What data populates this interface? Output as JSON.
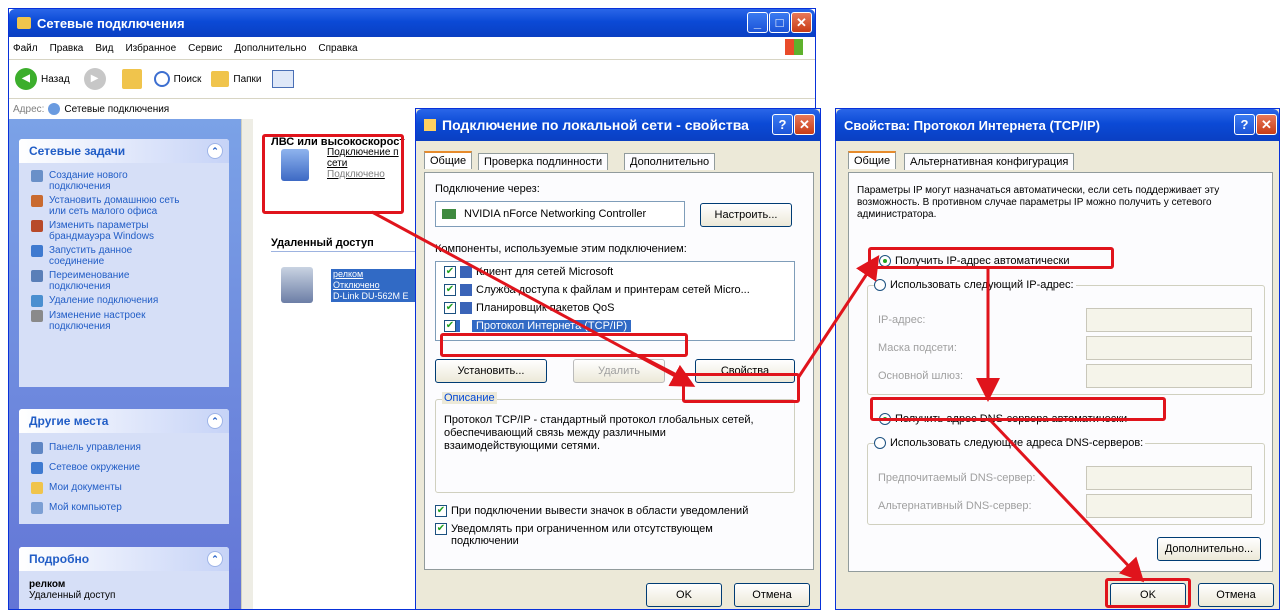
{
  "explorer": {
    "title": "Сетевые подключения",
    "menu": [
      "Файл",
      "Правка",
      "Вид",
      "Избранное",
      "Сервис",
      "Дополнительно",
      "Справка"
    ],
    "toolbar": {
      "back": "Назад",
      "search": "Поиск",
      "folders": "Папки"
    },
    "address_label": "Адрес:",
    "address_value": "Сетевые подключения",
    "tasks_title": "Сетевые задачи",
    "tasks": [
      "Создание нового подключения",
      "Установить домашнюю сеть или сеть малого офиса",
      "Изменить параметры брандмауэра Windows",
      "Запустить данное соединение",
      "Переименование подключения",
      "Удаление подключения",
      "Изменение настроек подключения"
    ],
    "places_title": "Другие места",
    "places": [
      "Панель управления",
      "Сетевое окружение",
      "Мои документы",
      "Мой компьютер"
    ],
    "details_title": "Подробно",
    "details_name": "релком",
    "details_sub": "Удаленный доступ",
    "lan_header": "ЛВС или высокоскорост",
    "lan_conn_name": "Подключение по сети",
    "lan_conn_line1": "Подключение п",
    "lan_conn_line2": "сети",
    "lan_conn_status": "Подключено",
    "remote_header": "Удаленный доступ",
    "remote_name": "релком",
    "remote_status": "Отключено",
    "remote_device": "D-Link DU-562M E"
  },
  "props": {
    "title": "Подключение по локальной сети - свойства",
    "tabs": [
      "Общие",
      "Проверка подлинности",
      "Дополнительно"
    ],
    "connect_via": "Подключение через:",
    "adapter": "NVIDIA nForce Networking Controller",
    "configure": "Настроить...",
    "components_label": "Компоненты, используемые этим подключением:",
    "components": [
      "Клиент для сетей Microsoft",
      "Служба доступа к файлам и принтерам сетей Micro...",
      "Планировщик пакетов QoS",
      "Протокол Интернета (TCP/IP)"
    ],
    "install": "Установить...",
    "remove": "Удалить",
    "properties": "Свойства",
    "desc_title": "Описание",
    "desc_text": "Протокол TCP/IP - стандартный протокол глобальных сетей, обеспечивающий связь между различными взаимодействующими сетями.",
    "show_icon": "При подключении вывести значок в области уведомлений",
    "notify": "Уведомлять при ограниченном или отсутствующем подключении",
    "ok": "OK",
    "cancel": "Отмена"
  },
  "tcpip": {
    "title": "Свойства: Протокол Интернета (TCP/IP)",
    "tabs": [
      "Общие",
      "Альтернативная конфигурация"
    ],
    "intro": "Параметры IP могут назначаться автоматически, если сеть поддерживает эту возможность. В противном случае параметры IP можно получить у сетевого администратора.",
    "auto_ip": "Получить IP-адрес автоматически",
    "manual_ip": "Использовать следующий IP-адрес:",
    "ip_label": "IP-адрес:",
    "mask_label": "Маска подсети:",
    "gateway_label": "Основной шлюз:",
    "auto_dns": "Получить адрес DNS-сервера автоматически",
    "manual_dns": "Использовать следующие адреса DNS-серверов:",
    "pref_dns": "Предпочитаемый DNS-сервер:",
    "alt_dns": "Альтернативный DNS-сервер:",
    "advanced": "Дополнительно...",
    "ok": "OK",
    "cancel": "Отмена"
  },
  "colors": {
    "xp_blue": "#0b4ad6",
    "dialog_bg": "#ece9d8",
    "highlight_red": "#e0141c",
    "selection": "#316ac5"
  }
}
